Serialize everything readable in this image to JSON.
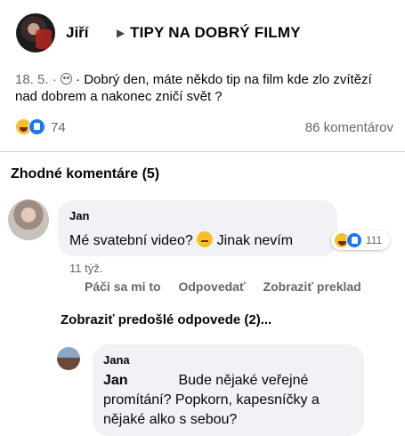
{
  "post": {
    "author": "Jiří",
    "group": "TIPY NA DOBRÝ FILMY",
    "date": "18. 5. ·",
    "text": "· Dobrý den, máte někdo tip na film kde zlo zvítězí nad dobrem a nakonec zničí svět ?",
    "reactions_count": "74",
    "comments_count": "86 komentárov"
  },
  "comments": {
    "section_title": "Zhodné komentáre (5)",
    "first": {
      "author": "Jan",
      "text_before": "Mé svatební video?",
      "text_after": "Jinak nevím",
      "reactions_count": "111",
      "time": "11 týž.",
      "like": "Páči sa mi to",
      "reply": "Odpovedať",
      "translate": "Zobraziť preklad"
    },
    "previous_replies": "Zobraziť predošlé odpovede (2)...",
    "reply": {
      "author": "Jana",
      "mention": "Jan",
      "text": "Bude nějaké veřejné promítání? Popkorn, kapesníčky a nějaké alko s sebou?"
    }
  },
  "icons": {
    "audience": "globe-icon",
    "reaction_1": "haha-icon",
    "reaction_2": "like-icon",
    "emoji": "thinking-face-icon",
    "arrow": "triangle-right-icon"
  },
  "colors": {
    "secondary_text": "#65676b",
    "bubble": "#f0f2f5",
    "like_blue": "#1877f2",
    "haha_yellow": "#f7c02b"
  }
}
